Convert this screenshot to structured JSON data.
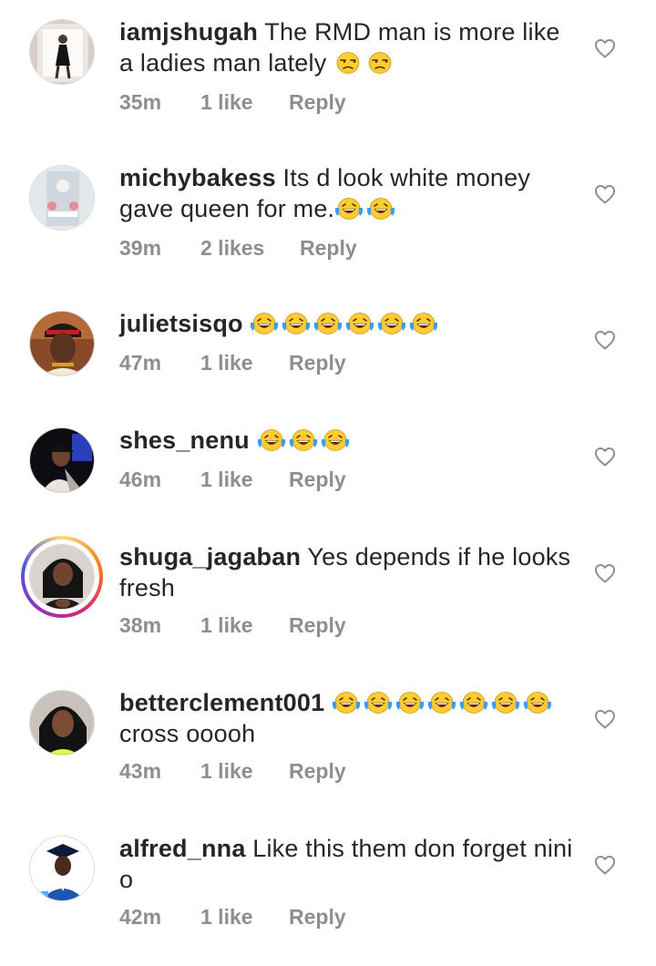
{
  "comments": [
    {
      "username": "iamjshugah",
      "text": "The RMD man is more like a ladies man lately",
      "emoji": [
        "unamused",
        "unamused"
      ],
      "time": "35m",
      "likes": "1 like",
      "reply": "Reply",
      "story": false
    },
    {
      "username": "michybakess",
      "text": "Its d look white money gave queen for me.",
      "emoji": [
        "laughing",
        "laughing"
      ],
      "time": "39m",
      "likes": "2 likes",
      "reply": "Reply",
      "story": false
    },
    {
      "username": "julietsisqo",
      "text": "",
      "emoji": [
        "laughing",
        "laughing",
        "laughing",
        "laughing",
        "laughing",
        "laughing"
      ],
      "time": "47m",
      "likes": "1 like",
      "reply": "Reply",
      "story": false
    },
    {
      "username": "shes_nenu",
      "text": "",
      "emoji": [
        "laughing",
        "laughing",
        "laughing"
      ],
      "time": "46m",
      "likes": "1 like",
      "reply": "Reply",
      "story": false
    },
    {
      "username": "shuga_jagaban",
      "text": "Yes depends if he looks fresh",
      "emoji": [],
      "time": "38m",
      "likes": "1 like",
      "reply": "Reply",
      "story": true
    },
    {
      "username": "betterclement001",
      "text": "cross ooooh",
      "emoji_first": true,
      "emoji": [
        "laughing",
        "laughing",
        "laughing",
        "laughing",
        "laughing",
        "laughing",
        "laughing"
      ],
      "time": "43m",
      "likes": "1 like",
      "reply": "Reply",
      "story": false
    },
    {
      "username": "alfred_nna",
      "text": "Like this them don forget nini o",
      "emoji": [],
      "time": "42m",
      "likes": "1 like",
      "reply": "Reply",
      "story": false
    }
  ],
  "icons": {
    "like": "heart-outline-icon"
  },
  "colors": {
    "text": "#262626",
    "meta": "#8e8e8e",
    "emoji_face": "#ffcc33",
    "tears": "#3b9cf0"
  }
}
